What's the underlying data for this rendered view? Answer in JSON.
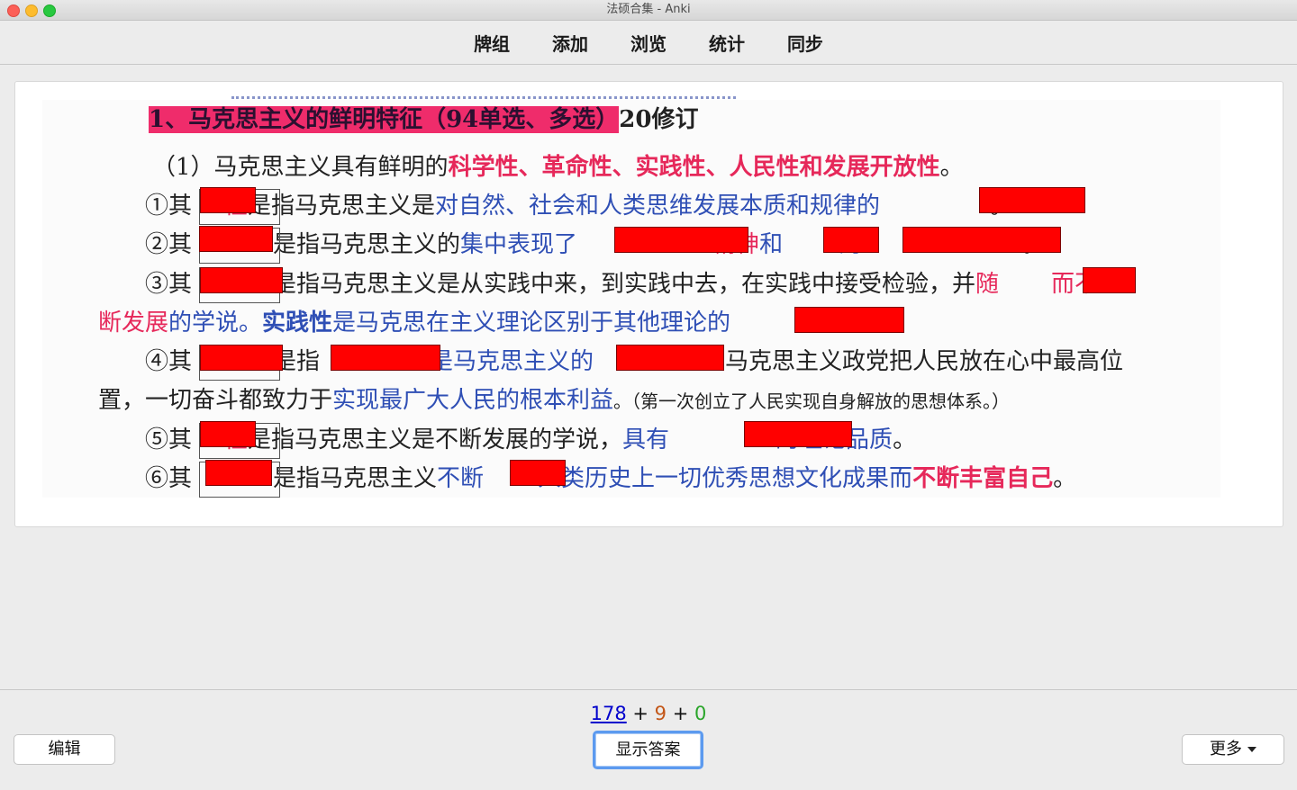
{
  "window": {
    "title": "法硕合集 - Anki"
  },
  "toolbar": {
    "decks": "牌组",
    "add": "添加",
    "browse": "浏览",
    "stats": "统计",
    "sync": "同步"
  },
  "card": {
    "line1": {
      "highlight": "1、马克思主义的鲜明特征（94单选、多选）",
      "suffix": "20修订"
    },
    "line2": {
      "prefix": "（1）",
      "mid": "马克思主义具有鲜明的",
      "pink": "科学性、革命性、实践性、人民性和发展开放性",
      "end": "。"
    },
    "line3": {
      "num": "①其",
      "boxed": "性",
      "a": "是指马克思主义是",
      "blue": "对自然、社会和人类思维发展本质和规律的",
      "end": "。"
    },
    "line4": {
      "num": "②其",
      "a": "是指马克思主义的",
      "blue": "集中表现了",
      "pink1": "精神",
      "blue2": "和",
      "blue3": "的",
      "end": "。"
    },
    "line5": {
      "num": "③其",
      "a": "是指马克思主义是从实践中来，到实践中去，在实践中接受检验，并",
      "pink1": "随",
      "pink2": "而不"
    },
    "line6": {
      "pink": "断发展",
      "blue": "的学说。",
      "bold": "实践性",
      "blue2": "是马克思在主义理论区别于其他理论的",
      "end": "。"
    },
    "line7": {
      "num": "④其",
      "a": "是指",
      "blue": "是马克思主义的",
      "tail": "。马克思主义政党把人民放在心中最高位"
    },
    "line8": {
      "a": "置，一切奋斗都致力于",
      "blue": "实现最广大人民的根本利益",
      "b": "。（第一次创立了人民实现自身解放的思想体系。）"
    },
    "line9": {
      "num": "⑤其",
      "boxed": "性",
      "a": "是指马克思主义是不断发展的学说，",
      "blue": "具有",
      "blue2": "的理论品质",
      "end": "。"
    },
    "line10": {
      "num": "⑥其",
      "a": "是指马克思主义",
      "blue": "不断",
      "blue2": "人类历史上一切优秀思想文化成果而",
      "pink": "不断丰富自己",
      "end": "。"
    }
  },
  "counts": {
    "new": "178",
    "plus1": " + ",
    "learning": "9",
    "plus2": " + ",
    "review": "0"
  },
  "buttons": {
    "edit": "编辑",
    "show_answer": "显示答案",
    "more": "更多"
  }
}
